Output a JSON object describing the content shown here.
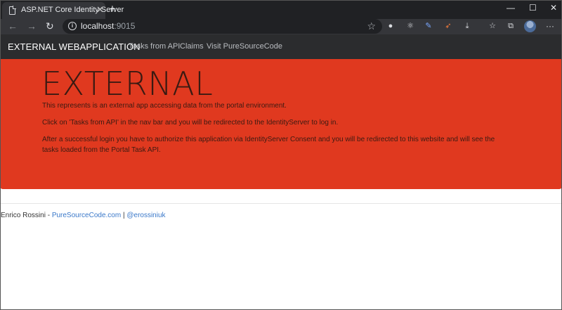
{
  "browser": {
    "tab_title": "ASP.NET Core Identity Server",
    "tab_close": "✕",
    "new_tab": "+",
    "window_controls": {
      "minimize": "—",
      "maximize": "☐",
      "close": "✕"
    },
    "toolbar": {
      "back": "←",
      "forward": "→",
      "reload": "↻",
      "star": "☆",
      "menu": "···"
    },
    "url_host": "localhost",
    "url_port": ":9015"
  },
  "site": {
    "brand": "EXTERNAL WEBAPPLICATION",
    "nav": [
      "Tasks from API",
      "Claims",
      "Visit PureSourceCode"
    ]
  },
  "jumbotron": {
    "title": "EXTERNAL",
    "paragraph_1": "This represents is an external app accessing data from the portal environment.",
    "paragraph_2": "Click on 'Tasks from API' in the nav bar and you will be redirected to the IdentityServer to log in.",
    "paragraph_3": "After a successful login you have to authorize this application via IdentityServer Consent and you will be redirected to this website and will see the tasks loaded from the Portal Task API."
  },
  "footer": {
    "author": "Enrico Rossini - ",
    "site_link": "PureSourceCode.com",
    "separator": " | ",
    "twitter_link": "@erossiniuk"
  },
  "colors": {
    "jumbotron_bg": "#e0391f",
    "navbar_bg": "#2b2c2e",
    "link": "#3a78c9"
  }
}
